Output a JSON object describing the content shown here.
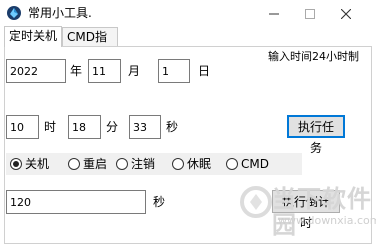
{
  "window": {
    "title": "常用小工具.",
    "controls": {
      "minimize": "—",
      "maximize": "☐",
      "close": "✕"
    }
  },
  "tabs": [
    {
      "label": "定时关机",
      "active": true
    },
    {
      "label": "CMD指令",
      "active": false
    }
  ],
  "hint": "输入时间24小时制",
  "date": {
    "year_value": "2022",
    "year_label": "年",
    "month_value": "11",
    "month_label": "月",
    "day_value": "1",
    "day_label": "日"
  },
  "time": {
    "hour_value": "10",
    "hour_label": "时",
    "minute_value": "18",
    "minute_label": "分",
    "second_value": "33",
    "second_label": "秒"
  },
  "execute_task_label": "执行任务",
  "actions": {
    "selected": "关机",
    "options": [
      "关机",
      "重启",
      "注销",
      "休眠",
      "CMD"
    ]
  },
  "countdown": {
    "value": "120",
    "unit_label": "秒",
    "button_label": "执行倒计时"
  },
  "watermark": {
    "text": "当下软件园",
    "url": "www.downxia.com"
  },
  "colors": {
    "accent": "#0078d7",
    "panel_bg": "#f0f0f0"
  }
}
